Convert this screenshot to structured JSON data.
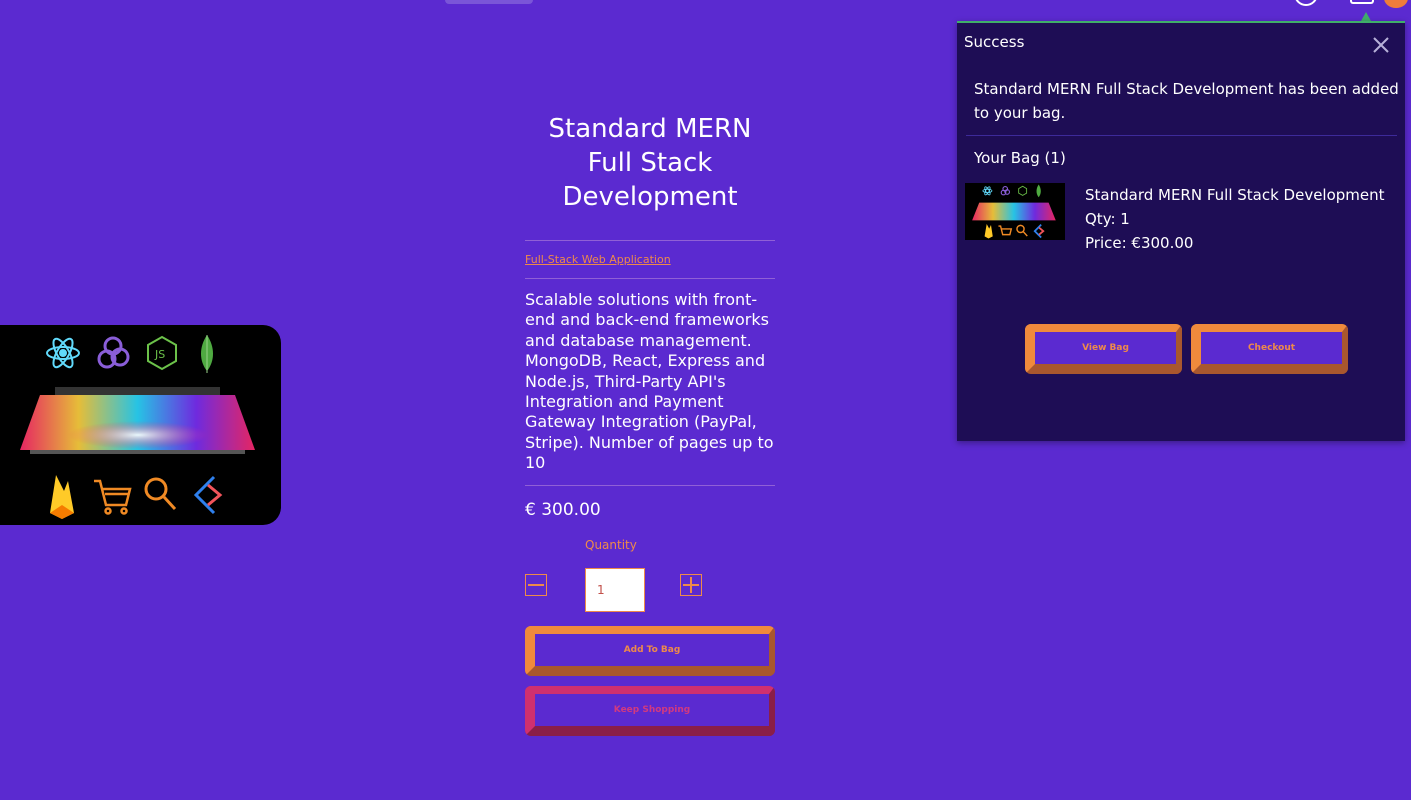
{
  "product": {
    "title": "Standard MERN Full Stack Development",
    "category": "Full-Stack Web Application",
    "description": "Scalable solutions with front-end and back-end frameworks and database management. MongoDB, React, Express and Node.js, Third-Party API's Integration and Payment Gateway Integration (PayPal, Stripe). Number of pages up to 10",
    "price": "€ 300.00",
    "image_icons": [
      "react-icon",
      "redux-icon",
      "nodejs-icon",
      "mongodb-icon",
      "firebase-icon",
      "cart-icon",
      "magnifier-icon",
      "api-icon"
    ]
  },
  "quantity": {
    "label": "Quantity",
    "value": "1",
    "minus_icon": "minus-icon",
    "plus_icon": "plus-icon"
  },
  "actions": {
    "add_to_bag": "Add To Bag",
    "keep_shopping": "Keep Shopping"
  },
  "popup": {
    "title": "Success",
    "message": "Standard MERN Full Stack Development has been added to your bag.",
    "bag_title": "Your Bag (1)",
    "item": {
      "name": "Standard MERN Full Stack Development",
      "qty": "Qty: 1",
      "price": "Price: €300.00"
    },
    "view_bag": "View Bag",
    "checkout": "Checkout"
  },
  "colors": {
    "background": "#5b2ad0",
    "accent_orange": "#ee8a4a",
    "accent_pink": "#d13a80",
    "popup_bg": "#1e0d55",
    "success_green": "#3fae6a"
  }
}
